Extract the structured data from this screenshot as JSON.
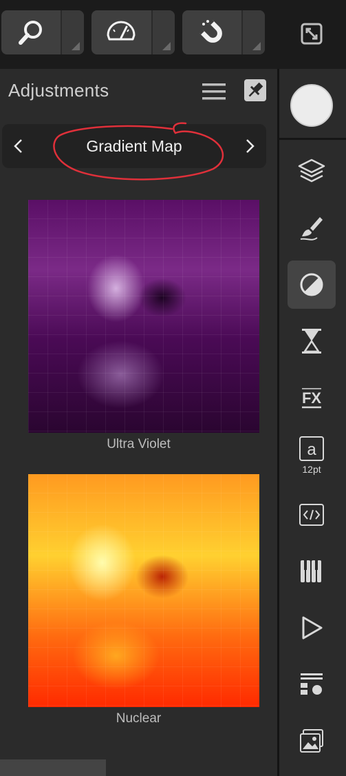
{
  "toolbar": {
    "tools": [
      {
        "icon": "zoom-icon"
      },
      {
        "icon": "view-speedometer-icon"
      },
      {
        "icon": "snapping-magnet-icon"
      }
    ],
    "expand_icon": "expand-icon"
  },
  "panel": {
    "title": "Adjustments",
    "menu_icon": "hamburger-menu-icon",
    "pin_icon": "pin-icon"
  },
  "navigator": {
    "current": "Gradient Map",
    "prev_icon": "chevron-left-icon",
    "next_icon": "chevron-right-icon"
  },
  "presets": [
    {
      "name": "Ultra Violet"
    },
    {
      "name": "Nuclear"
    }
  ],
  "studio": {
    "character_size": "12pt",
    "icons": [
      "layers-icon",
      "brushes-icon",
      "adjustments-icon",
      "history-icon",
      "effects-fx-icon",
      "character-icon",
      "code-icon",
      "swatches-icon",
      "play-icon",
      "properties-icon",
      "stock-images-icon"
    ]
  },
  "colors": {
    "background": "#1b1b1b",
    "panel": "#2b2b2b",
    "button": "#3f3f3f",
    "annotation": "#e0303a"
  }
}
